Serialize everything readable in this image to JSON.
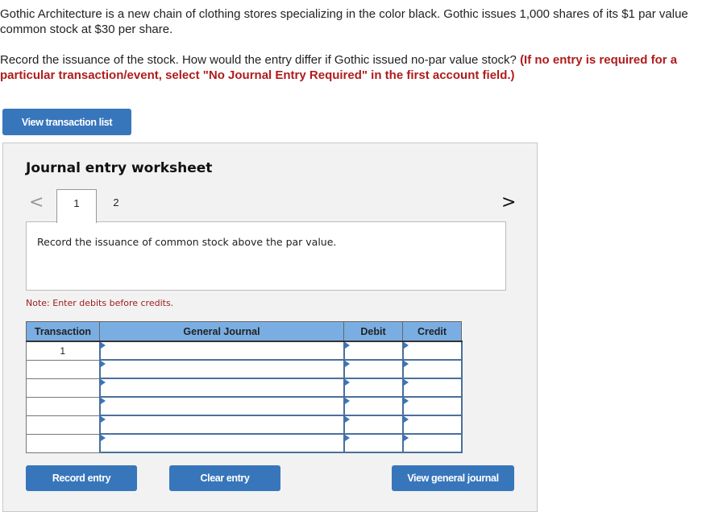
{
  "question": {
    "paragraph1": "Gothic Architecture is a new chain of clothing stores specializing in the color black. Gothic issues 1,000 shares of its $1 par value common stock at $30 per share.",
    "paragraph2_plain": "Record the issuance of the stock. How would the entry differ if Gothic issued no-par value stock? ",
    "paragraph2_emphasis": "(If no entry is required for a particular transaction/event, select \"No Journal Entry Required\" in the first account field.)"
  },
  "buttons": {
    "view_transaction_list": "View transaction list",
    "record_entry": "Record entry",
    "clear_entry": "Clear entry",
    "view_general_journal": "View general journal"
  },
  "worksheet": {
    "title": "Journal entry worksheet",
    "prev_icon": "chevron-left-icon",
    "next_icon": "chevron-right-icon",
    "prev_glyph": "<",
    "next_glyph": ">",
    "tabs": [
      {
        "label": "1",
        "active": true
      },
      {
        "label": "2",
        "active": false
      }
    ],
    "description": "Record the issuance of common stock above the par value.",
    "note": "Note: Enter debits before credits."
  },
  "journal_table": {
    "columns": [
      "Transaction",
      "General Journal",
      "Debit",
      "Credit"
    ],
    "rows": [
      {
        "transaction": "1",
        "account": "",
        "debit": "",
        "credit": ""
      },
      {
        "transaction": "",
        "account": "",
        "debit": "",
        "credit": ""
      },
      {
        "transaction": "",
        "account": "",
        "debit": "",
        "credit": ""
      },
      {
        "transaction": "",
        "account": "",
        "debit": "",
        "credit": ""
      },
      {
        "transaction": "",
        "account": "",
        "debit": "",
        "credit": ""
      },
      {
        "transaction": "",
        "account": "",
        "debit": "",
        "credit": ""
      }
    ]
  },
  "colors": {
    "button_blue": "#3876bb",
    "header_blue": "#7aaee3",
    "emphasis_red": "#b01c1c",
    "panel_bg": "#f2f2f2"
  }
}
